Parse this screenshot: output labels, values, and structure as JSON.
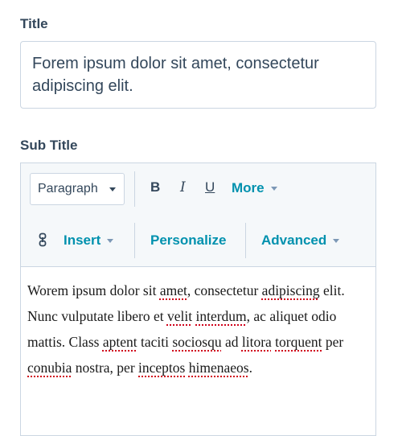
{
  "title_field": {
    "label": "Title",
    "value": "Forem ipsum dolor sit amet, consectetur adipiscing elit."
  },
  "subtitle_field": {
    "label": "Sub Title",
    "toolbar": {
      "paragraph_select": "Paragraph",
      "bold": "B",
      "italic": "I",
      "underline": "U",
      "more": "More",
      "insert": "Insert",
      "personalize": "Personalize",
      "advanced": "Advanced"
    },
    "content": {
      "segments": [
        {
          "text": "Worem ipsum dolor sit "
        },
        {
          "text": "amet",
          "misspelled": true
        },
        {
          "text": ", consectetur "
        },
        {
          "text": "adipiscing",
          "misspelled": true
        },
        {
          "text": " elit. Nunc vulputate libero et "
        },
        {
          "text": "velit",
          "misspelled": true
        },
        {
          "text": " "
        },
        {
          "text": "interdum",
          "misspelled": true
        },
        {
          "text": ", ac aliquet odio mattis. Class "
        },
        {
          "text": "aptent",
          "misspelled": true
        },
        {
          "text": " taciti "
        },
        {
          "text": "sociosqu",
          "misspelled": true
        },
        {
          "text": " ad "
        },
        {
          "text": "litora",
          "misspelled": true
        },
        {
          "text": " "
        },
        {
          "text": "torquent",
          "misspelled": true
        },
        {
          "text": " per "
        },
        {
          "text": "conubia",
          "misspelled": true
        },
        {
          "text": " nostra, per "
        },
        {
          "text": "inceptos",
          "misspelled": true
        },
        {
          "text": " "
        },
        {
          "text": "himenaeos",
          "misspelled": true
        },
        {
          "text": "."
        }
      ]
    }
  },
  "colors": {
    "label_text": "#33475b",
    "accent_teal": "#0091ae",
    "border": "#cbd6e2",
    "toolbar_bg": "#f5f8fa",
    "spellcheck": "#d0021b"
  },
  "icons": {
    "link": "link-icon",
    "dropdown": "chevron-down-icon"
  }
}
